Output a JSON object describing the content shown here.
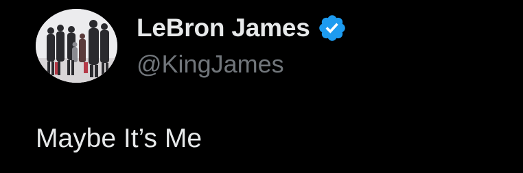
{
  "tweet": {
    "author": {
      "display_name": "LeBron James",
      "handle": "@KingJames",
      "verified": true,
      "verified_color": "#1d9bf0",
      "avatar_icon": "profile-photo-group"
    },
    "text": "Maybe It’s Me"
  },
  "colors": {
    "background": "#000000",
    "primary_text": "#e7e9ea",
    "secondary_text": "#71767b",
    "accent": "#1d9bf0"
  }
}
